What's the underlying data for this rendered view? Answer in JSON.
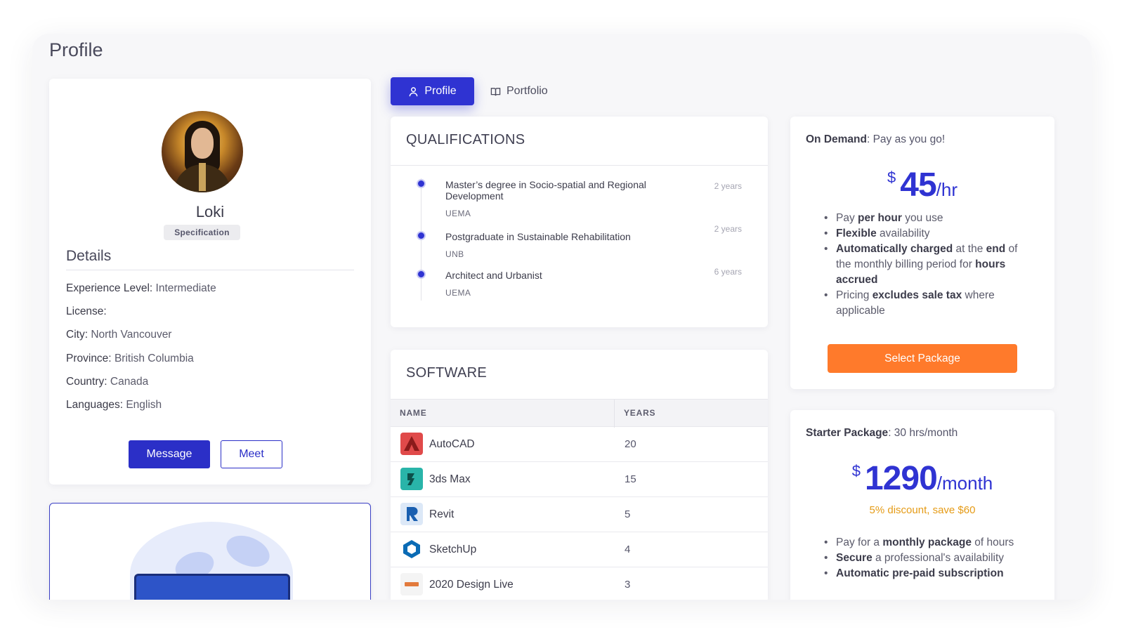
{
  "page": {
    "title": "Profile"
  },
  "profile": {
    "name": "Loki",
    "badge": "Specification",
    "details_title": "Details",
    "details": [
      {
        "label": "Experience Level:",
        "value": "Intermediate"
      },
      {
        "label": "License:",
        "value": ""
      },
      {
        "label": "City:",
        "value": "North Vancouver"
      },
      {
        "label": "Province:",
        "value": "British Columbia"
      },
      {
        "label": "Country:",
        "value": "Canada"
      },
      {
        "label": "Languages:",
        "value": "English"
      }
    ],
    "message_label": "Message",
    "meet_label": "Meet"
  },
  "tabs": [
    {
      "label": "Profile",
      "icon": "user-icon",
      "active": true
    },
    {
      "label": "Portfolio",
      "icon": "book-icon",
      "active": false
    }
  ],
  "qualifications": {
    "title": "QUALIFICATIONS",
    "items": [
      {
        "title": "Master’s degree in Socio-spatial and Regional Development",
        "institution": "UEMA",
        "duration": "2 years"
      },
      {
        "title": "Postgraduate in Sustainable Rehabilitation",
        "institution": "UNB",
        "duration": "2 years"
      },
      {
        "title": "Architect and Urbanist",
        "institution": "UEMA",
        "duration": "6 years"
      }
    ]
  },
  "software": {
    "title": "SOFTWARE",
    "columns": [
      "NAME",
      "YEARS"
    ],
    "rows": [
      {
        "name": "AutoCAD",
        "years": "20",
        "icon": "autocad-icon"
      },
      {
        "name": "3ds Max",
        "years": "15",
        "icon": "3dsmax-icon"
      },
      {
        "name": "Revit",
        "years": "5",
        "icon": "revit-icon"
      },
      {
        "name": "SketchUp",
        "years": "4",
        "icon": "sketchup-icon"
      },
      {
        "name": "2020 Design Live",
        "years": "3",
        "icon": "2020-design-icon"
      }
    ]
  },
  "pricing": {
    "on_demand": {
      "name": "On Demand",
      "tagline": ": Pay as you go!",
      "currency": "$",
      "amount": "45",
      "unit": "/hr",
      "features": [
        {
          "pre": "Pay ",
          "bold": "per hour",
          "post": " you use"
        },
        {
          "pre": "",
          "bold": "Flexible",
          "post": " availability"
        },
        {
          "pre": "",
          "bold": "Automatically charged",
          "post": " at the ",
          "bold2": "end",
          "post2": " of the monthly billing period for ",
          "bold3": "hours accrued",
          "post3": ""
        },
        {
          "pre": "Pricing ",
          "bold": "excludes sale tax",
          "post": " where applicable"
        }
      ],
      "button_label": "Select Package"
    },
    "starter": {
      "name": "Starter Package",
      "tagline": ": 30 hrs/month",
      "currency": "$",
      "amount": "1290",
      "unit": "/month",
      "discount": "5% discount, save $60",
      "features": [
        {
          "pre": "Pay for a ",
          "bold": "monthly package",
          "post": " of hours"
        },
        {
          "pre": "",
          "bold": "Secure",
          "post": " a professional's availability"
        },
        {
          "pre": "",
          "bold": "Automatic pre-paid subscription",
          "post": ""
        }
      ]
    },
    "accent_color": "#2f33d2",
    "cta_color": "#ff7a2b",
    "discount_color": "#e59b16"
  }
}
